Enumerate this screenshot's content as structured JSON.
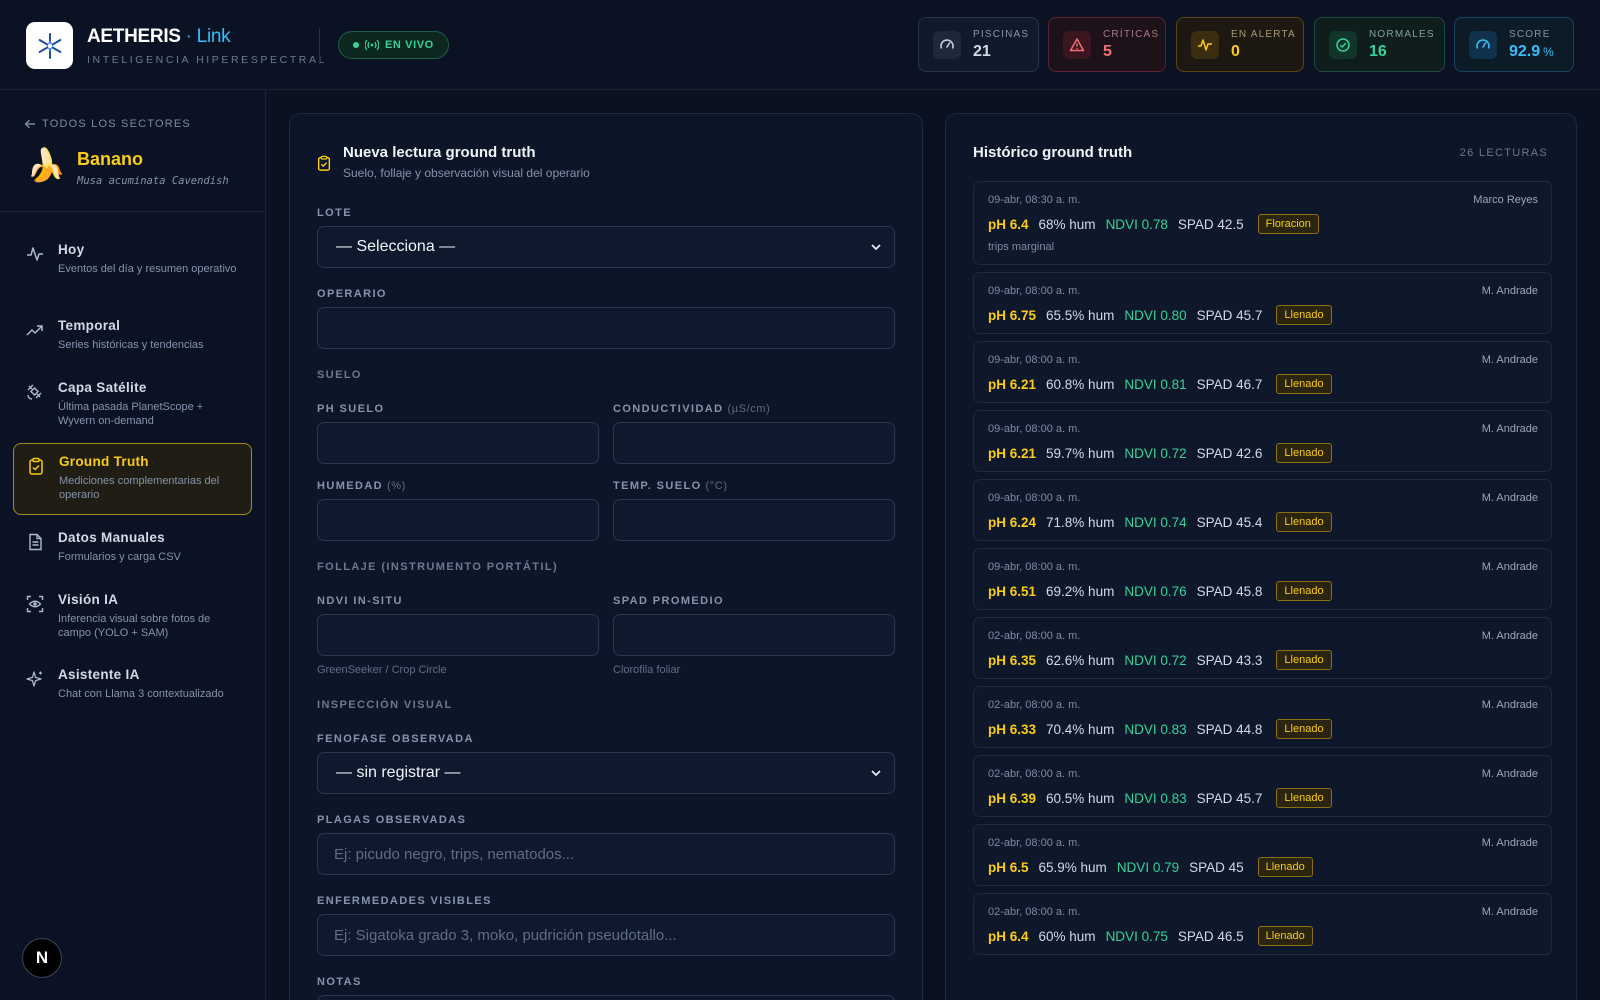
{
  "app": {
    "name": "AETHERIS",
    "separator": "·",
    "suffix": "Link",
    "subtitle": "INTELIGENCIA HIPERESPECTRAL",
    "live_label": "EN VIVO"
  },
  "stats": [
    {
      "label": "PISCINAS",
      "value": "21",
      "icon": "gauge-icon",
      "color": "#d2dae6"
    },
    {
      "label": "CRÍTICAS",
      "value": "5",
      "icon": "alert-triangle-icon",
      "color": "#f87171"
    },
    {
      "label": "EN ALERTA",
      "value": "0",
      "icon": "activity-icon",
      "color": "#facc15"
    },
    {
      "label": "NORMALES",
      "value": "16",
      "icon": "check-circle-icon",
      "color": "#34d399"
    },
    {
      "label": "SCORE",
      "value": "92.9",
      "unit": "%",
      "icon": "gauge-icon",
      "color": "#38bdf8"
    }
  ],
  "sidebar": {
    "back_label": "TODOS LOS SECTORES",
    "crop": {
      "emoji": "🍌",
      "name": "Banano",
      "scientific": "Musa acuminata Cavendish"
    },
    "items": [
      {
        "title": "Hoy",
        "desc": "Eventos del día y resumen operativo",
        "icon": "pulse-icon",
        "active": false
      },
      {
        "title": "Temporal",
        "desc": "Series históricas y tendencias",
        "icon": "trending-up-icon",
        "active": false
      },
      {
        "title": "Capa Satélite",
        "desc": "Última pasada PlanetScope + Wyvern on-demand",
        "icon": "satellite-icon",
        "active": false
      },
      {
        "title": "Ground Truth",
        "desc": "Mediciones complementarias del operario",
        "icon": "clipboard-check-icon",
        "active": true
      },
      {
        "title": "Datos Manuales",
        "desc": "Formularios y carga CSV",
        "icon": "file-text-icon",
        "active": false
      },
      {
        "title": "Visión IA",
        "desc": "Inferencia visual sobre fotos de campo (YOLO + SAM)",
        "icon": "scan-eye-icon",
        "active": false
      },
      {
        "title": "Asistente IA",
        "desc": "Chat con Llama 3 contextualizado",
        "icon": "sparkles-icon",
        "active": false
      }
    ],
    "badge": "N"
  },
  "form": {
    "title": "Nueva lectura ground truth",
    "subtitle": "Suelo, follaje y observación visual del operario",
    "lote_label": "LOTE",
    "lote_value": "— Selecciona —",
    "operario_label": "OPERARIO",
    "operario_value": "",
    "suelo_section": "SUELO",
    "ph_label": "PH SUELO",
    "cond_label": "CONDUCTIVIDAD",
    "cond_unit": "(µS/cm)",
    "hum_label": "HUMEDAD",
    "hum_unit": "(%)",
    "temp_label": "TEMP. SUELO",
    "temp_unit": "(°C)",
    "follaje_section": "FOLLAJE (INSTRUMENTO PORTÁTIL)",
    "ndvi_label": "NDVI IN-SITU",
    "ndvi_hint": "GreenSeeker / Crop Circle",
    "spad_label": "SPAD PROMEDIO",
    "spad_hint": "Clorofila foliar",
    "visual_section": "INSPECCIÓN VISUAL",
    "fenofase_label": "FENOFASE OBSERVADA",
    "fenofase_value": "— sin registrar —",
    "plagas_label": "PLAGAS OBSERVADAS",
    "plagas_placeholder": "Ej: picudo negro, trips, nematodos...",
    "enfermedades_label": "ENFERMEDADES VISIBLES",
    "enfermedades_placeholder": "Ej: Sigatoka grado 3, moko, pudrición pseudotallo...",
    "notas_label": "NOTAS"
  },
  "history": {
    "title": "Histórico ground truth",
    "count": "26 LECTURAS",
    "readings": [
      {
        "date": "09-abr, 08:30 a. m.",
        "operator": "Marco Reyes",
        "ph": "pH 6.4",
        "hum": "68% hum",
        "ndvi": "NDVI 0.78",
        "spad": "SPAD 42.5",
        "stage": "Floracion",
        "note": "trips marginal"
      },
      {
        "date": "09-abr, 08:00 a. m.",
        "operator": "M. Andrade",
        "ph": "pH 6.75",
        "hum": "65.5% hum",
        "ndvi": "NDVI 0.80",
        "spad": "SPAD 45.7",
        "stage": "Llenado"
      },
      {
        "date": "09-abr, 08:00 a. m.",
        "operator": "M. Andrade",
        "ph": "pH 6.21",
        "hum": "60.8% hum",
        "ndvi": "NDVI 0.81",
        "spad": "SPAD 46.7",
        "stage": "Llenado"
      },
      {
        "date": "09-abr, 08:00 a. m.",
        "operator": "M. Andrade",
        "ph": "pH 6.21",
        "hum": "59.7% hum",
        "ndvi": "NDVI 0.72",
        "spad": "SPAD 42.6",
        "stage": "Llenado"
      },
      {
        "date": "09-abr, 08:00 a. m.",
        "operator": "M. Andrade",
        "ph": "pH 6.24",
        "hum": "71.8% hum",
        "ndvi": "NDVI 0.74",
        "spad": "SPAD 45.4",
        "stage": "Llenado"
      },
      {
        "date": "09-abr, 08:00 a. m.",
        "operator": "M. Andrade",
        "ph": "pH 6.51",
        "hum": "69.2% hum",
        "ndvi": "NDVI 0.76",
        "spad": "SPAD 45.8",
        "stage": "Llenado"
      },
      {
        "date": "02-abr, 08:00 a. m.",
        "operator": "M. Andrade",
        "ph": "pH 6.35",
        "hum": "62.6% hum",
        "ndvi": "NDVI 0.72",
        "spad": "SPAD 43.3",
        "stage": "Llenado"
      },
      {
        "date": "02-abr, 08:00 a. m.",
        "operator": "M. Andrade",
        "ph": "pH 6.33",
        "hum": "70.4% hum",
        "ndvi": "NDVI 0.83",
        "spad": "SPAD 44.8",
        "stage": "Llenado"
      },
      {
        "date": "02-abr, 08:00 a. m.",
        "operator": "M. Andrade",
        "ph": "pH 6.39",
        "hum": "60.5% hum",
        "ndvi": "NDVI 0.83",
        "spad": "SPAD 45.7",
        "stage": "Llenado"
      },
      {
        "date": "02-abr, 08:00 a. m.",
        "operator": "M. Andrade",
        "ph": "pH 6.5",
        "hum": "65.9% hum",
        "ndvi": "NDVI 0.79",
        "spad": "SPAD 45",
        "stage": "Llenado"
      },
      {
        "date": "02-abr, 08:00 a. m.",
        "operator": "M. Andrade",
        "ph": "pH 6.4",
        "hum": "60% hum",
        "ndvi": "NDVI 0.75",
        "spad": "SPAD 46.5",
        "stage": "Llenado"
      }
    ]
  }
}
